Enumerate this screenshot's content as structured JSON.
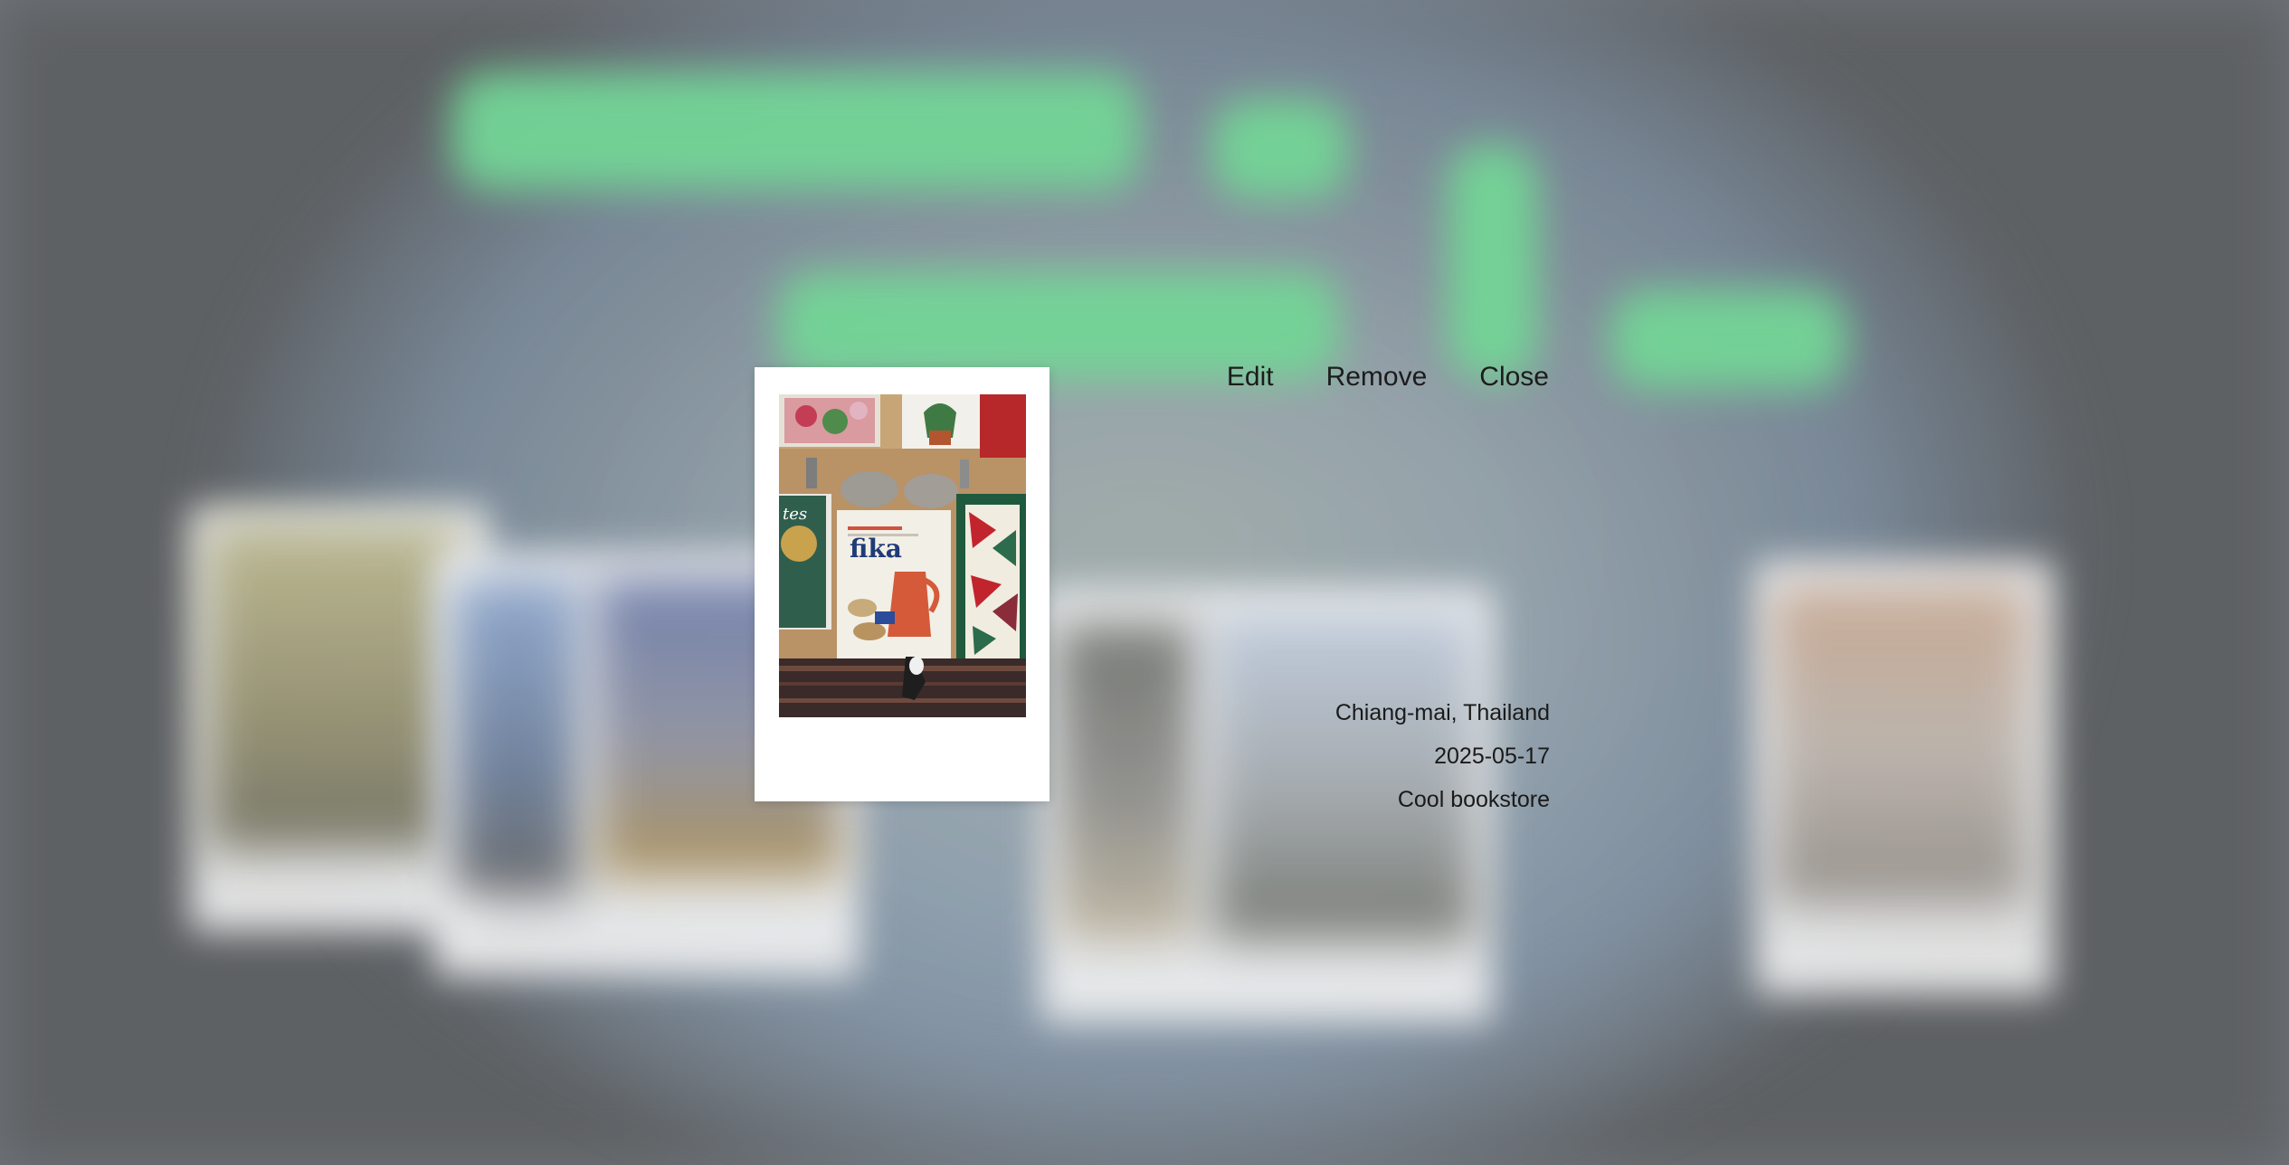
{
  "photo": {
    "alt": "Photo of books on a bookstore table",
    "book_cover_text": "fika"
  },
  "actions": {
    "edit_label": "Edit",
    "remove_label": "Remove",
    "close_label": "Close"
  },
  "details": {
    "location": "Chiang-mai, Thailand",
    "date": "2025-05-17",
    "caption": "Cool bookstore"
  },
  "colors": {
    "accent_green": "#73d596",
    "polaroid_frame": "#ffffff",
    "text": "#1a1a1a"
  }
}
